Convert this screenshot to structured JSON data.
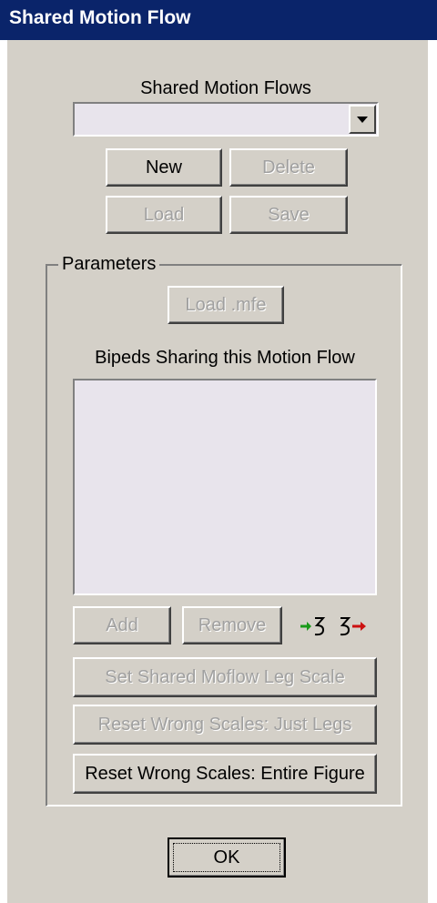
{
  "window": {
    "title": "Shared Motion Flow"
  },
  "flows": {
    "label": "Shared Motion Flows",
    "selected": "",
    "new_label": "New",
    "delete_label": "Delete",
    "load_label": "Load",
    "save_label": "Save"
  },
  "parameters": {
    "legend": "Parameters",
    "load_mfe_label": "Load .mfe",
    "bipeds_label": "Bipeds Sharing this Motion Flow",
    "add_label": "Add",
    "remove_label": "Remove",
    "set_leg_scale_label": "Set Shared Moflow Leg Scale",
    "reset_legs_label": "Reset Wrong Scales: Just Legs",
    "reset_entire_label": "Reset Wrong Scales: Entire Figure"
  },
  "footer": {
    "ok_label": "OK"
  },
  "colors": {
    "titlebar": "#0a246a",
    "add_arrow": "#1a9a1a",
    "remove_arrow": "#cc1111"
  }
}
